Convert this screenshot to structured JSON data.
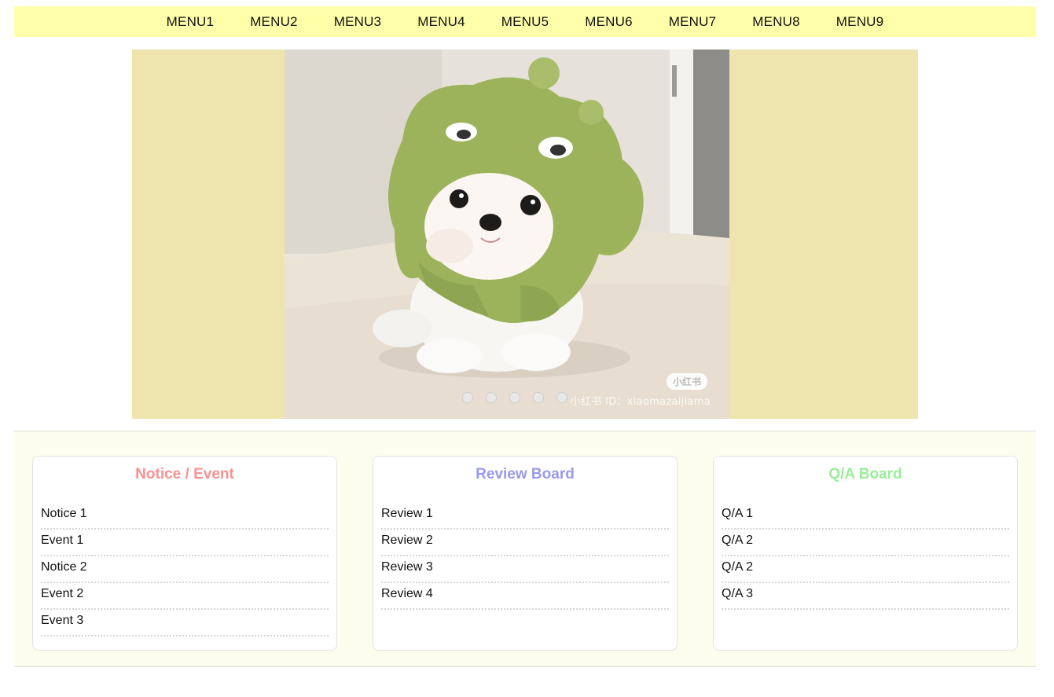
{
  "nav": {
    "items": [
      "MENU1",
      "MENU2",
      "MENU3",
      "MENU4",
      "MENU5",
      "MENU6",
      "MENU7",
      "MENU8",
      "MENU9"
    ]
  },
  "slider": {
    "background_color": "#eee5ae",
    "dots_count": 5,
    "watermark_badge": "小红书",
    "watermark_text": "小红书 ID：xiaomazaijiama"
  },
  "boards": [
    {
      "title": "Notice / Event",
      "color": "#ff8f8f",
      "items": [
        "Notice 1",
        "Event 1",
        "Notice 2",
        "Event 2",
        "Event 3"
      ]
    },
    {
      "title": "Review Board",
      "color": "#9999ee",
      "items": [
        "Review 1",
        "Review 2",
        "Review 3",
        "Review 4"
      ]
    },
    {
      "title": "Q/A Board",
      "color": "#99ee99",
      "items": [
        "Q/A 1",
        "Q/A 2",
        "Q/A 2",
        "Q/A 3"
      ]
    }
  ]
}
